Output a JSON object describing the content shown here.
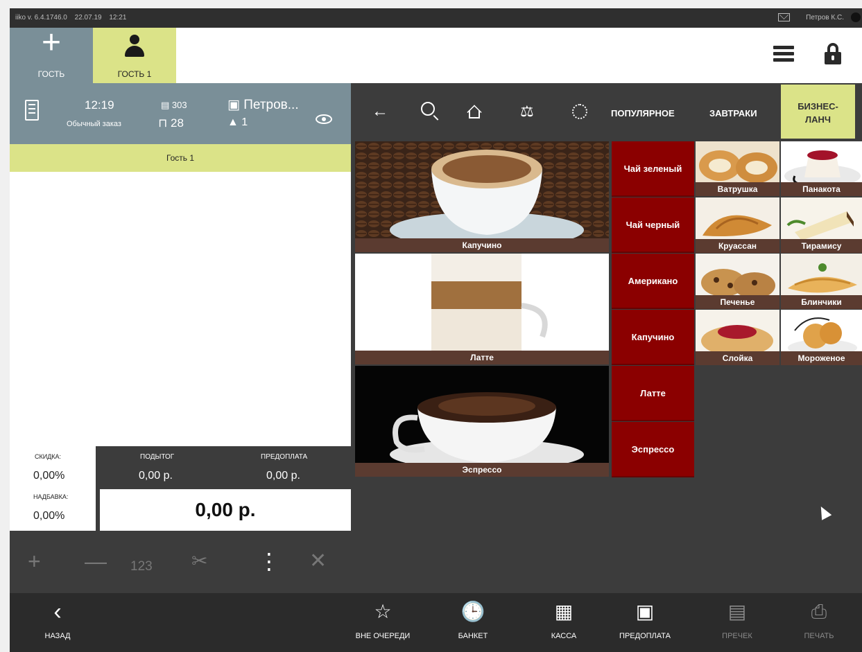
{
  "status": {
    "version": "iiko v. 6.4.1746.0",
    "date": "22.07.19",
    "time": "12:21",
    "user": "Петров К.С."
  },
  "guestbar": {
    "add_label": "ГОСТЬ",
    "guest1_label": "ГОСТЬ 1"
  },
  "order": {
    "time": "12:19",
    "type": "Обычный заказ",
    "number": "303",
    "table": "28",
    "waiter": "Петров...",
    "guests": "1",
    "guest_row": "Гость 1"
  },
  "totals": {
    "discount_label": "СКИДКА:",
    "discount_value": "0,00%",
    "surcharge_label": "НАДБАВКА:",
    "surcharge_value": "0,00%",
    "subtotal_label": "ПОДЫТОГ",
    "subtotal_value": "0,00 р.",
    "prepay_label": "ПРЕДОПЛАТА",
    "prepay_value": "0,00 р.",
    "total": "0,00 р."
  },
  "tools": {
    "plus": "+",
    "minus": "—",
    "qty": "123",
    "more": "⋮",
    "close": "✕"
  },
  "catnav": {
    "popular": "ПОПУЛЯРНОЕ",
    "breakfast": "ЗАВТРАКИ",
    "business_1": "БИЗНЕС-",
    "business_2": "ЛАНЧ"
  },
  "products": {
    "big": [
      "Капучино",
      "Латте",
      "Эспрессо"
    ],
    "drinks": [
      "Чай зеленый",
      "Чай черный",
      "Американо",
      "Капучино",
      "Латте",
      "Эспрессо"
    ],
    "desserts": [
      "Ватрушка",
      "Панакота",
      "Круассан",
      "Тирамису",
      "Печенье",
      "Блинчики",
      "Слойка",
      "Мороженое"
    ]
  },
  "bottom": {
    "back": "НАЗАД",
    "queue": "ВНЕ ОЧЕРЕДИ",
    "banquet": "БАНКЕТ",
    "cash": "КАССА",
    "prepay": "ПРЕДОПЛАТА",
    "precheck": "ПРЕЧЕК",
    "print": "ПЕЧАТЬ"
  },
  "colors": {
    "accent": "#dbe388",
    "header": "#7a8f98",
    "product_red": "#8b0000",
    "caption_brown": "#5b3b30"
  }
}
